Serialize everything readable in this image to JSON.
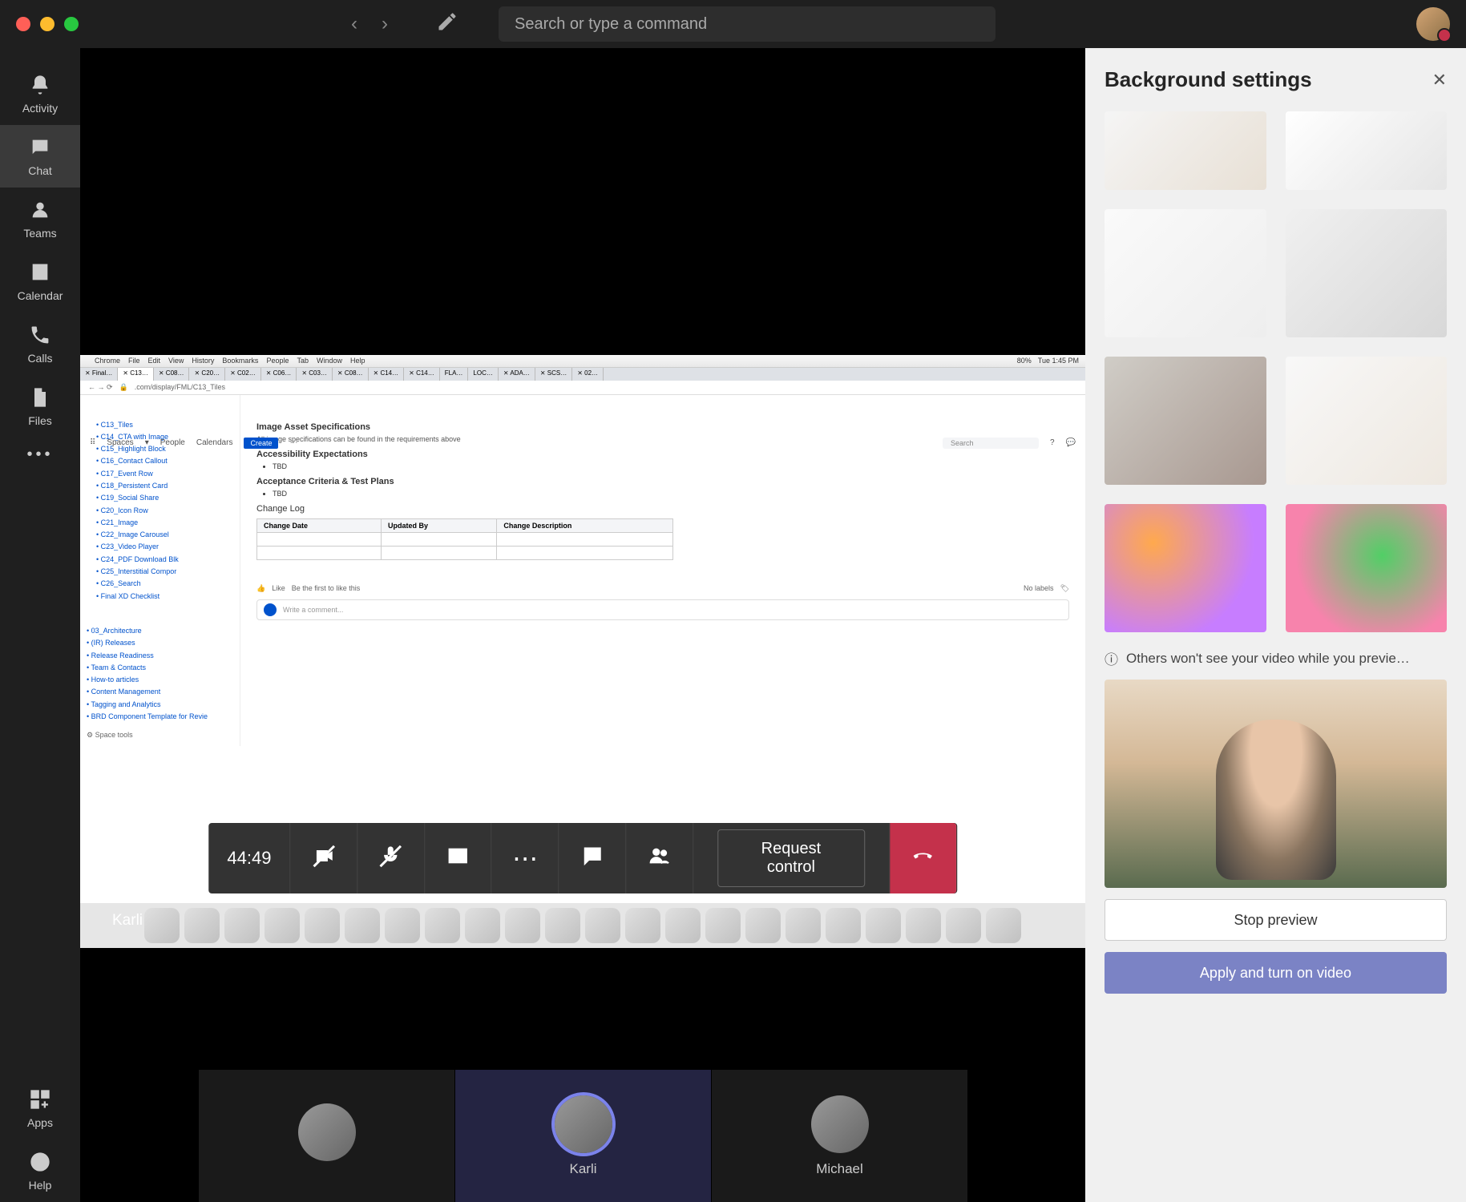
{
  "titlebar": {
    "search_placeholder": "Search or type a command"
  },
  "rail": {
    "activity": "Activity",
    "chat": "Chat",
    "teams": "Teams",
    "calendar": "Calendar",
    "calls": "Calls",
    "files": "Files",
    "apps": "Apps",
    "help": "Help"
  },
  "call": {
    "timer": "44:49",
    "request_control": "Request control",
    "presenter": "Karli"
  },
  "participants": [
    {
      "name": ""
    },
    {
      "name": "Karli"
    },
    {
      "name": "Michael"
    }
  ],
  "panel": {
    "title": "Background settings",
    "info": "Others won't see your video while you previe…",
    "stop": "Stop preview",
    "apply": "Apply and turn on video"
  },
  "shared": {
    "mac_menu": [
      "Chrome",
      "File",
      "Edit",
      "View",
      "History",
      "Bookmarks",
      "People",
      "Tab",
      "Window",
      "Help"
    ],
    "mac_time": "Tue 1:45 PM",
    "mac_battery": "80%",
    "address": ".com/display/FML/C13_Tiles",
    "conf_nav": [
      "Spaces",
      "People",
      "Calendars"
    ],
    "conf_create": "Create",
    "conf_search": "Search",
    "tree_items": [
      "C13_Tiles",
      "C14_CTA with Image",
      "C15_Highlight Block",
      "C16_Contact Callout",
      "C17_Event Row",
      "C18_Persistent Card",
      "C19_Social Share",
      "C20_Icon Row",
      "C21_Image",
      "C22_Image Carousel",
      "C23_Video Player",
      "C24_PDF Download Blk",
      "C25_Interstitial Compor",
      "C26_Search",
      "Final XD Checklist"
    ],
    "tree_bottom": [
      "03_Architecture",
      "(IR) Releases",
      "Release Readiness",
      "Team & Contacts",
      "How-to articles",
      "Content Management",
      "Tagging and Analytics",
      "BRD Component Template for Revie"
    ],
    "space_tools": "Space tools",
    "h1": "Image Asset Specifications",
    "p1": "All image specifications can be found in the requirements above",
    "h2": "Accessibility Expectations",
    "h3": "Acceptance Criteria & Test Plans",
    "tbd": "TBD",
    "h4": "Change Log",
    "table_headers": [
      "Change Date",
      "Updated By",
      "Change Description"
    ],
    "like": "Like",
    "be_first": "Be the first to like this",
    "no_labels": "No labels",
    "comment": "Write a comment..."
  }
}
